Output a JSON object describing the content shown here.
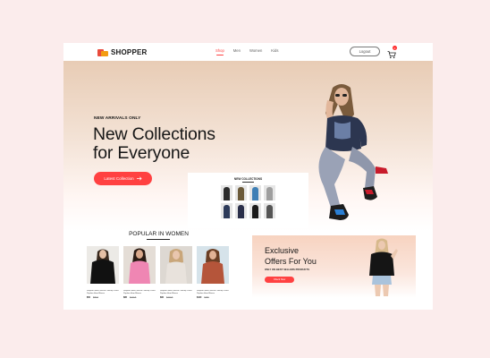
{
  "nav": {
    "brand": "SHOPPER",
    "menu": [
      {
        "label": "Shop",
        "active": true
      },
      {
        "label": "Men",
        "active": false
      },
      {
        "label": "Women",
        "active": false
      },
      {
        "label": "Kids",
        "active": false
      }
    ],
    "login_label": "Logout",
    "cart_count": "0",
    "cart_icon": "cart-icon"
  },
  "hero": {
    "eyebrow": "NEW ARRIVALS ONLY",
    "title_line1": "New Collections",
    "title_line2": "for Everyone",
    "button_label": "Latest Collection",
    "button_icon": "arrow-right-icon"
  },
  "new_collections": {
    "title": "NEW COLLECTIONS"
  },
  "popular": {
    "title": "POPULAR IN WOMEN",
    "items": [
      {
        "name": "Striped Flutter Sleeve Overlap Collar Peplum Hem Blouse",
        "new_price": "$50",
        "old_price": "$80.5"
      },
      {
        "name": "Striped Flutter Sleeve Overlap Collar Peplum Hem Blouse",
        "new_price": "$85",
        "old_price": "$120.5"
      },
      {
        "name": "Striped Flutter Sleeve Overlap Collar Peplum Hem Blouse",
        "new_price": "$60",
        "old_price": "$100.5"
      },
      {
        "name": "Striped Flutter Sleeve Overlap Collar Peplum Hem Blouse",
        "new_price": "$100",
        "old_price": "$150"
      }
    ]
  },
  "offers": {
    "title_line1": "Exclusive",
    "title_line2": "Offers For You",
    "subtitle": "ONLY ON BEST SELLERS PRODUCTS",
    "button_label": "Check Now"
  },
  "colors": {
    "accent": "#ff4141",
    "page_bg": "#fbecec"
  }
}
